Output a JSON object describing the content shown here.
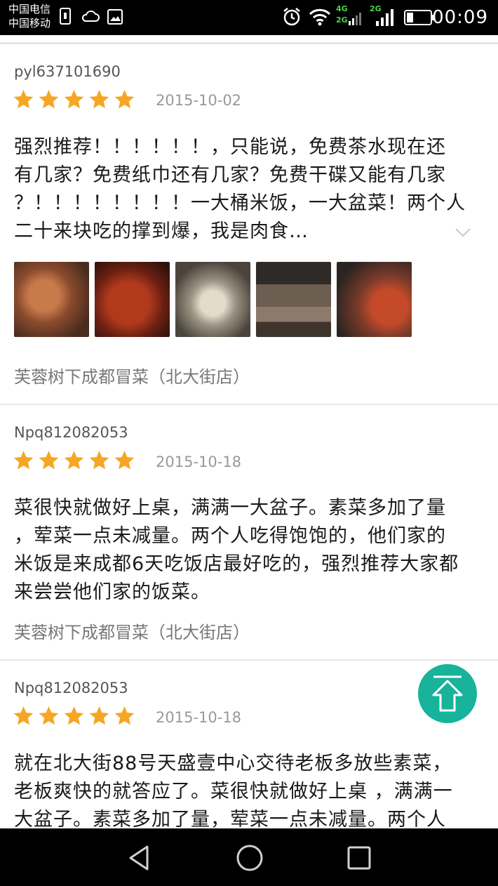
{
  "status_bar": {
    "carrier_1": "中国电信",
    "carrier_2": "中国移动",
    "net_4g": "4G",
    "net_2g_a": "2G",
    "net_2g_b": "2G",
    "time": "00:09"
  },
  "reviews": [
    {
      "username": "pyl637101690",
      "rating": 5,
      "date": "2015-10-02",
      "lines": [
        "强烈推荐！！！！！！，只能说，免费茶水现在还",
        "有几家？免费纸巾还有几家？免费干碟又能有几家",
        "？！！！！！！！！一大桶米饭，一大盆菜！两个人",
        "二十来块吃的撑到爆，我是肉食…"
      ],
      "photos": [
        {
          "name": "dish-photo-1",
          "colors": [
            "#8a4b2e",
            "#c9a17a",
            "#5b3a2a"
          ]
        },
        {
          "name": "dish-photo-2",
          "colors": [
            "#6a1f12",
            "#b23a1c",
            "#3b1a10"
          ]
        },
        {
          "name": "dish-photo-3",
          "colors": [
            "#7a7466",
            "#cfc6b6",
            "#3a3630"
          ]
        },
        {
          "name": "dish-photo-4",
          "colors": [
            "#2d2a28",
            "#8d7a6a",
            "#514438"
          ]
        },
        {
          "name": "dish-photo-5",
          "colors": [
            "#5a4036",
            "#c44a2a",
            "#2a2522"
          ]
        }
      ],
      "shop": "芙蓉树下成都冒菜（北大街店）"
    },
    {
      "username": "Npq812082053",
      "rating": 5,
      "date": "2015-10-18",
      "lines": [
        "菜很快就做好上桌，满满一大盆子。素菜多加了量",
        "，荤菜一点未减量。两个人吃得饱饱的，他们家的",
        "米饭是来成都6天吃饭店最好吃的，强烈推荐大家都",
        "来尝尝他们家的饭菜。"
      ],
      "shop": "芙蓉树下成都冒菜（北大街店）"
    },
    {
      "username": "Npq812082053",
      "rating": 5,
      "date": "2015-10-18",
      "lines": [
        "就在北大街88号天盛壹中心交待老板多放些素菜，",
        "老板爽快的就答应了。菜很快就做好上桌  ，满满一",
        "大盆子。素菜多加了量，荤菜一点未减量。两个人"
      ]
    }
  ],
  "colors": {
    "star": "#f5a623",
    "accent_fab": "#17b39a"
  },
  "icons": {
    "back": "back-triangle-icon",
    "home": "home-circle-icon",
    "recents": "recents-square-icon",
    "scroll_top": "scroll-to-top-icon",
    "expand": "chevron-down-icon"
  }
}
